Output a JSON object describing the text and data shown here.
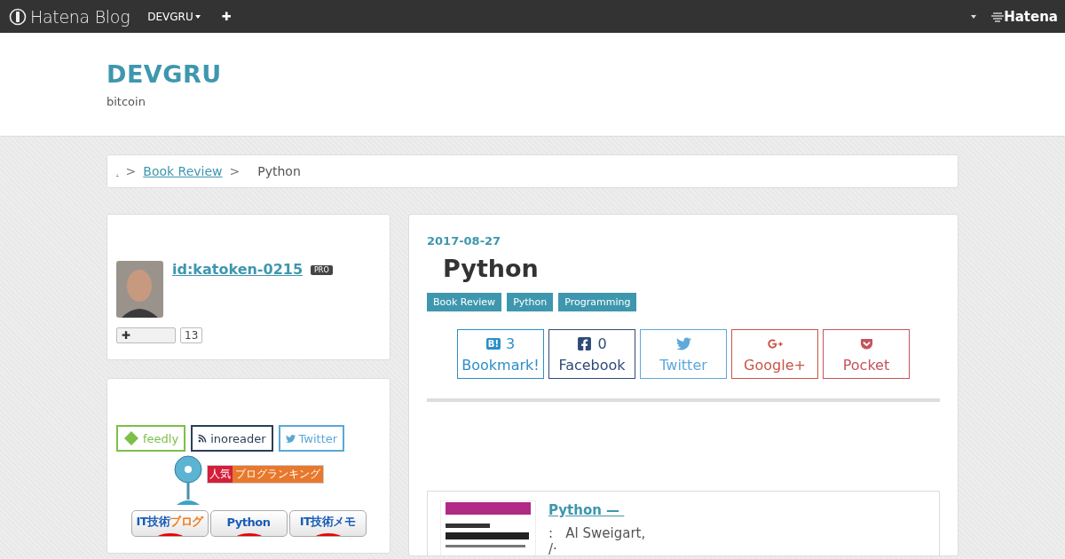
{
  "top_bar": {
    "logo": "Hatena Blog",
    "blog_menu": "DEVGRU",
    "add": "✚",
    "brand": "Hatena"
  },
  "header": {
    "title": "DEVGRU",
    "description": "bitcoin"
  },
  "breadcrumb": [
    {
      "kind": "link",
      "label": "."
    },
    {
      "kind": "separator",
      "label": ">"
    },
    {
      "kind": "link",
      "label": "Book Review"
    },
    {
      "kind": "separator",
      "label": ">"
    },
    {
      "kind": "current",
      "label": "Python"
    }
  ],
  "profile": {
    "username": "id:katoken-0215",
    "badge": "PRO",
    "follow": "✚",
    "follow_count": "13"
  },
  "subscribe": {
    "buttons": [
      {
        "kind": "feedly",
        "label": "feedly",
        "color": "#7cbf4a"
      },
      {
        "kind": "inoreader",
        "label": "inoreader",
        "color": "#2b3e55"
      },
      {
        "kind": "twitter",
        "label": "Twitter",
        "color": "#5aa7d6"
      }
    ],
    "ranking": {
      "badge": "人気",
      "label": "ブログランキング"
    },
    "ranking_buttons": [
      {
        "main": "IT技術",
        "accent": "ブログ"
      },
      {
        "main": "Python"
      },
      {
        "main": "IT技術メモ"
      }
    ]
  },
  "article": {
    "date": "2017-08-27",
    "title": "Python",
    "categories": [
      "Book Review",
      "Python",
      "Programming"
    ],
    "share": [
      {
        "kind": "hatena",
        "icon_text": "B!",
        "count": "3",
        "label": "Bookmark!",
        "color": "#2b8fc7"
      },
      {
        "kind": "facebook",
        "count": "0",
        "label": "Facebook",
        "color": "#2f4a78"
      },
      {
        "kind": "twitter",
        "label": "Twitter",
        "color": "#5ea9d8"
      },
      {
        "kind": "googleplus",
        "label": "Google+",
        "color": "#c95445"
      },
      {
        "kind": "pocket",
        "label": "Pocket",
        "color": "#c4535c"
      }
    ],
    "book": {
      "kind": "picture",
      "title": "Python — ",
      "lines": [
        ":   Al Sweigart,",
        "/·"
      ]
    }
  }
}
